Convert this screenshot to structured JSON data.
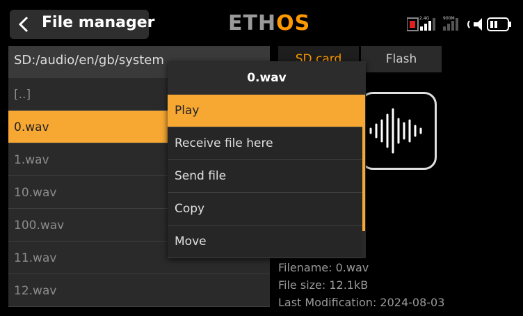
{
  "header": {
    "title": "File manager",
    "logo_left": "ETH",
    "logo_right": "OS",
    "back_icon": "chevron-left-icon",
    "status_icons": [
      "record-icon",
      "signal-2.4g-icon",
      "signal-900m-icon",
      "volume-icon",
      "battery-icon"
    ],
    "signal_labels": [
      "2.4G",
      "900M"
    ]
  },
  "path": "SD:/audio/en/gb/system",
  "files": [
    {
      "name": "[..]"
    },
    {
      "name": "0.wav"
    },
    {
      "name": "1.wav"
    },
    {
      "name": "10.wav"
    },
    {
      "name": "100.wav"
    },
    {
      "name": "11.wav"
    },
    {
      "name": "12.wav"
    }
  ],
  "selected_file": "0.wav",
  "tabs": [
    {
      "label": "SD card",
      "active": true
    },
    {
      "label": "Flash",
      "active": false
    }
  ],
  "preview_icon": "audio-wave-icon",
  "file_info": {
    "filename": "Filename: 0.wav",
    "size": "File size: 12.1kB",
    "modified": "Last Modification: 2024-08-03"
  },
  "modal": {
    "title": "0.wav",
    "items": [
      {
        "label": "Play",
        "active": true
      },
      {
        "label": "Receive file here",
        "active": false
      },
      {
        "label": "Send file",
        "active": false
      },
      {
        "label": "Copy",
        "active": false
      },
      {
        "label": "Move",
        "active": false
      }
    ]
  },
  "colors": {
    "accent": "#f7a833",
    "logo_accent": "#ff9900",
    "background": "#000000",
    "panel": "#2a2a2a"
  }
}
